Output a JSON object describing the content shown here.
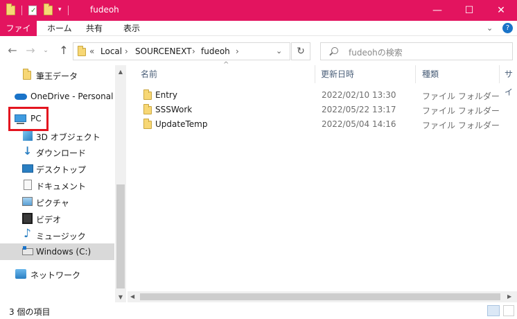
{
  "window": {
    "title": "fudeoh",
    "controls": {
      "minimize": "—",
      "maximize": "☐",
      "close": "✕"
    }
  },
  "ribbon": {
    "tabs": [
      "ファイル",
      "ホーム",
      "共有",
      "表示"
    ],
    "expand_icon": "chevron-down-icon",
    "help_icon": "help-icon",
    "help_glyph": "?"
  },
  "address": {
    "overflow": "«",
    "crumbs": [
      "Local",
      "SOURCENEXT",
      "fudeoh"
    ],
    "separator": "›"
  },
  "search": {
    "placeholder": "fudeohの検索"
  },
  "navpane": {
    "items": [
      {
        "label": "筆王データ",
        "icon": "folder-icon"
      },
      {
        "label": "OneDrive - Personal",
        "icon": "cloud-icon"
      },
      {
        "label": "PC",
        "icon": "computer-icon"
      },
      {
        "label": "3D オブジェクト",
        "icon": "3d-objects-icon"
      },
      {
        "label": "ダウンロード",
        "icon": "download-icon"
      },
      {
        "label": "デスクトップ",
        "icon": "desktop-icon"
      },
      {
        "label": "ドキュメント",
        "icon": "document-icon"
      },
      {
        "label": "ピクチャ",
        "icon": "pictures-icon"
      },
      {
        "label": "ビデオ",
        "icon": "video-icon"
      },
      {
        "label": "ミュージック",
        "icon": "music-icon"
      },
      {
        "label": "Windows (C:)",
        "icon": "drive-icon",
        "selected": true
      },
      {
        "label": "ネットワーク",
        "icon": "network-icon"
      }
    ]
  },
  "columns": [
    "名前",
    "更新日時",
    "種類",
    "サイ"
  ],
  "files": [
    {
      "name": "Entry",
      "modified": "2022/02/10 13:30",
      "type": "ファイル フォルダー"
    },
    {
      "name": "SSSWork",
      "modified": "2022/05/22 13:17",
      "type": "ファイル フォルダー"
    },
    {
      "name": "UpdateTemp",
      "modified": "2022/05/04 14:16",
      "type": "ファイル フォルダー"
    }
  ],
  "status": {
    "item_count": "3 個の項目"
  },
  "colors": {
    "titlebar": "#e3145f",
    "highlight_box": "#e3141f",
    "selected": "#d9d9d9"
  }
}
